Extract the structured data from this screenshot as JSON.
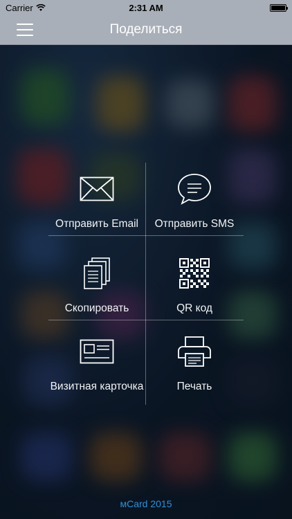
{
  "status_bar": {
    "carrier": "Carrier",
    "time": "2:31 AM"
  },
  "nav": {
    "title": "Поделиться",
    "menu_icon": "hamburger-menu-icon"
  },
  "share_options": [
    {
      "label": "Отправить Email",
      "icon": "envelope-icon"
    },
    {
      "label": "Отправить SMS",
      "icon": "chat-bubble-icon"
    },
    {
      "label": "Скопировать",
      "icon": "copy-documents-icon"
    },
    {
      "label": "QR код",
      "icon": "qr-code-icon"
    },
    {
      "label": "Визитная карточка",
      "icon": "business-card-icon"
    },
    {
      "label": "Печать",
      "icon": "printer-icon"
    }
  ],
  "footer": {
    "text": "мCard 2015"
  },
  "colors": {
    "nav_bg": "#a9afb8",
    "footer_accent": "#2f8fd8"
  }
}
